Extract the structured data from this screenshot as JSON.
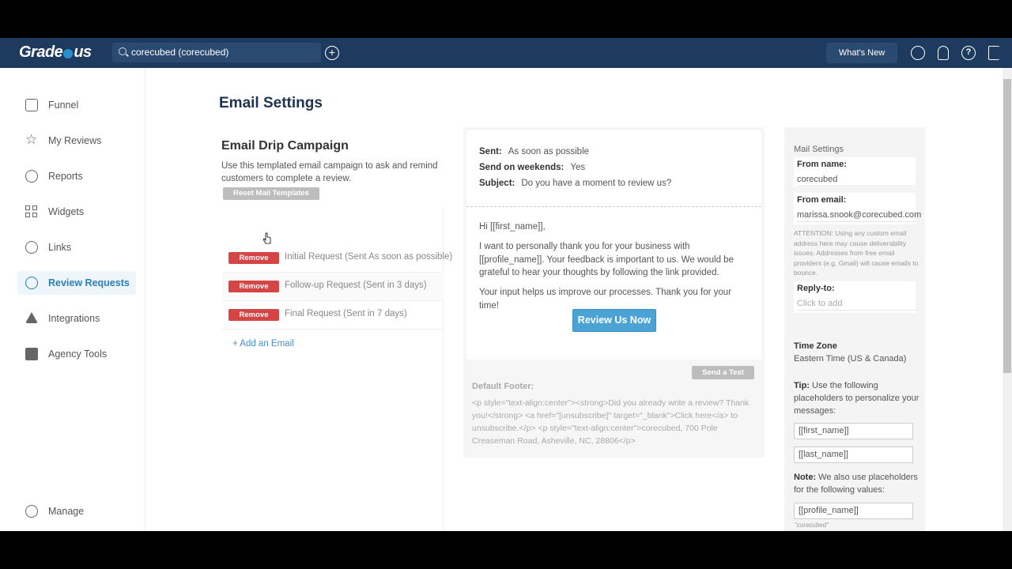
{
  "topnav": {
    "logo": "Grade.us",
    "search_value": "corecubed (corecubed)",
    "whats_new": "What's New",
    "icons": [
      "user-icon",
      "bell-icon",
      "help-icon",
      "logout-icon"
    ]
  },
  "sidebar": {
    "items": [
      {
        "label": "Funnel",
        "icon": "funnel-icon"
      },
      {
        "label": "My Reviews",
        "icon": "star-icon"
      },
      {
        "label": "Reports",
        "icon": "pie-chart-icon"
      },
      {
        "label": "Widgets",
        "icon": "grid-icon"
      },
      {
        "label": "Links",
        "icon": "link-icon"
      },
      {
        "label": "Review Requests",
        "icon": "chat-bubble-icon",
        "active": true
      },
      {
        "label": "Integrations",
        "icon": "network-icon"
      },
      {
        "label": "Agency Tools",
        "icon": "briefcase-icon"
      }
    ],
    "manage": "Manage"
  },
  "main": {
    "page_title": "Email Settings",
    "drip": {
      "title": "Email Drip Campaign",
      "description": "Use this templated email campaign to ask and remind customers to complete a review.",
      "reset_label": "Reset Mail Templates",
      "remove_label": "Remove",
      "emails": [
        "Initial Request (Sent As soon as possible)",
        "Follow-up Request (Sent in 3 days)",
        "Final Request (Sent in 7 days)"
      ],
      "add_email": "+ Add an Email"
    },
    "preview": {
      "sent_label": "Sent:",
      "sent_value": "As soon as possible",
      "weekends_label": "Send on weekends:",
      "weekends_value": "Yes",
      "subject_label": "Subject:",
      "subject_value": "Do you have a moment to review us?",
      "greeting": "Hi [[first_name]],",
      "paragraph1": "I want to personally thank you for your business with [[profile_name]]. Your feedback is important to us. We would be grateful to hear your thoughts by following the link provided.",
      "paragraph2": "Your input helps us improve our processes. Thank you for your time!",
      "cta": "Review Us Now",
      "send_test": "Send a Test",
      "footer_label": "Default Footer:",
      "footer_text": "<p style=\"text-align:center\"><strong>Did you already write a review? Thank you!</strong> <a href=\"[unsubscribe]\" target=\"_blank\">Click here</a> to unsubscribe.</p> <p style=\"text-align:center\">corecubed, 700 Pole Creaseman Road, Asheville, NC, 28806</p>"
    },
    "settings": {
      "title": "Mail Settings",
      "from_name_label": "From name:",
      "from_name_value": "corecubed",
      "from_email_label": "From email:",
      "from_email_value": "marissa.snook@corecubed.com",
      "attention": "ATTENTION: Using any custom email address here may cause deliverability issues. Addresses from free email providers (e.g. Gmail) will cause emails to bounce.",
      "reply_to_label": "Reply-to:",
      "reply_to_placeholder": "Click to add",
      "timezone_label": "Time Zone",
      "timezone_value": "Eastern Time (US & Canada)",
      "tip_bold": "Tip:",
      "tip_text": " Use the following placeholders to personalize your messages:",
      "placeholder1": "[[first_name]]",
      "placeholder2": "[[last_name]]",
      "note_bold": "Note:",
      "note_text": " We also use placeholders for the following values:",
      "placeholder3": "[[profile_name]]",
      "placeholder3_note": "\"corecubed\""
    }
  },
  "colors": {
    "nav_bg": "#1e3a5f",
    "accent": "#2a7fb8",
    "remove": "#d64545",
    "cta": "#4aa3d4"
  }
}
